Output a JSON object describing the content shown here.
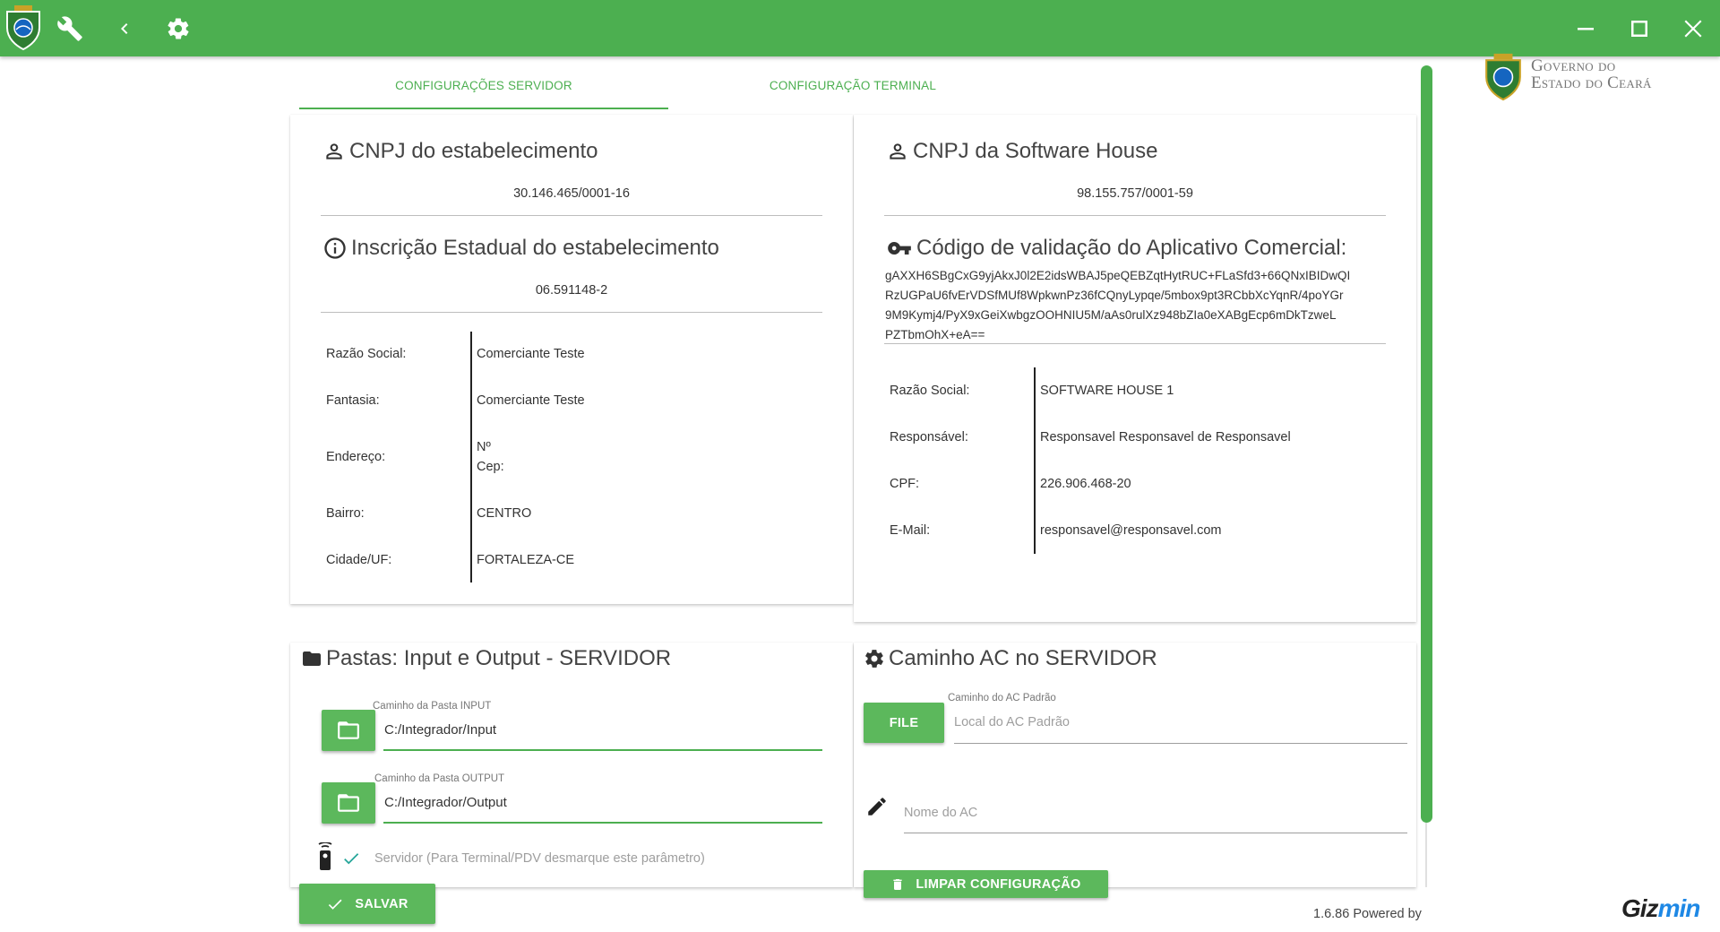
{
  "titlebar": {
    "icons": [
      "badge-icon",
      "wrench-icon",
      "chevron-left-icon",
      "gear-icon"
    ],
    "window_controls": [
      "minimize-icon",
      "maximize-icon",
      "close-icon"
    ],
    "color": "#4caf50"
  },
  "gov_logo": {
    "line1": "Governo do",
    "line2": "Estado do Ceará"
  },
  "tabs": [
    {
      "label": "CONFIGURAÇÕES SERVIDOR",
      "active": true
    },
    {
      "label": "CONFIGURAÇÃO TERMINAL",
      "active": false
    }
  ],
  "estabelecimento": {
    "cnpj_title": "CNPJ do estabelecimento",
    "cnpj_value": "30.146.465/0001-16",
    "ie_title": "Inscrição Estadual do estabelecimento",
    "ie_value": "06.591148-2",
    "rows": [
      {
        "label": "Razão Social:",
        "value": "Comerciante Teste"
      },
      {
        "label": "Fantasia:",
        "value": "Comerciante Teste"
      },
      {
        "label": "Endereço:",
        "value": "Nº",
        "value2": "Cep:"
      },
      {
        "label": "Bairro:",
        "value": "CENTRO"
      },
      {
        "label": "Cidade/UF:",
        "value": "FORTALEZA-CE"
      }
    ]
  },
  "software_house": {
    "cnpj_title": "CNPJ da Software House",
    "cnpj_value": "98.155.757/0001-59",
    "codigo_title": "Código de validação do Aplicativo Comercial:",
    "codigo_lines": [
      "gAXXH6SBgCxG9yjAkxJ0l2E2idsWBAJ5peQEBZqtHytRUC+FLaSfd3+66QNxIBIDwQI",
      "RzUGPaU6fvErVDSfMUf8WpkwnPz36fCQnyLypqe/5mbox9pt3RCbbXcYqnR/4poYGr",
      "9M9Kymj4/PyX9xGeiXwbgzOOHNIU5M/aAs0rulXz948bZIa0eXABgEcp6mDkTzweL",
      "PZTbmOhX+eA=="
    ],
    "rows": [
      {
        "label": "Razão Social:",
        "value": "SOFTWARE HOUSE 1"
      },
      {
        "label": "Responsável:",
        "value": "Responsavel Responsavel de Responsavel"
      },
      {
        "label": "CPF:",
        "value": "226.906.468-20"
      },
      {
        "label": "E-Mail:",
        "value": "responsavel@responsavel.com"
      }
    ]
  },
  "pastas": {
    "title": "Pastas: Input e Output - SERVIDOR",
    "input_label": "Caminho da Pasta INPUT",
    "input_value": "C:/Integrador/Input",
    "output_label": "Caminho da Pasta OUTPUT",
    "output_value": "C:/Integrador/Output",
    "servidor_checkbox_label": "Servidor (Para Terminal/PDV desmarque este parâmetro)",
    "servidor_checked": true
  },
  "caminho_ac": {
    "title": "Caminho AC no SERVIDOR",
    "file_button": "FILE",
    "ac_padrao_label": "Caminho do AC Padrão",
    "ac_padrao_placeholder": "Local do AC Padrão",
    "nome_placeholder": "Nome do AC",
    "limpar_button": "LIMPAR CONFIGURAÇÃO"
  },
  "footer": {
    "salvar_button": "SALVAR",
    "version": "1.6.86 Powered by",
    "brand_part1": "Giz",
    "brand_part2": "min"
  }
}
